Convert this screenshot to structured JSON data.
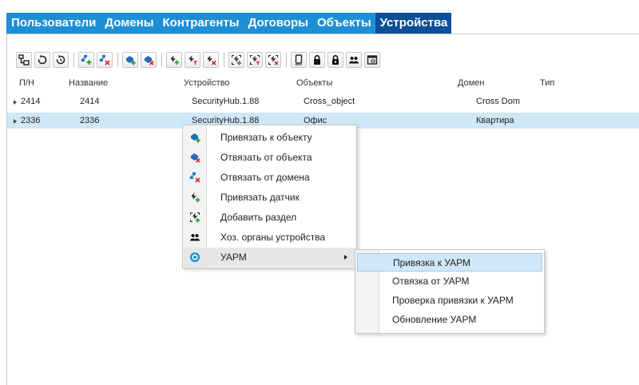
{
  "tabs": [
    {
      "label": "Пользователи",
      "active": false
    },
    {
      "label": "Домены",
      "active": false
    },
    {
      "label": "Контрагенты",
      "active": false
    },
    {
      "label": "Договоры",
      "active": false
    },
    {
      "label": "Объекты",
      "active": false
    },
    {
      "label": "Устройства",
      "active": true
    }
  ],
  "toolbar": {
    "icons": [
      "device-tree-icon",
      "refresh-icon",
      "refresh-timer-icon",
      "domain-bind-icon",
      "domain-unbind-icon",
      "object-bind-icon",
      "object-unbind-icon",
      "sensor-add-icon",
      "sensor-edit-icon",
      "sensor-remove-icon",
      "section-add-icon",
      "section-edit-icon",
      "section-remove-icon",
      "device-phone-icon",
      "lock-icon",
      "lock-arm-icon",
      "users-icon",
      "window-icon"
    ]
  },
  "columns": {
    "pn": "П/Н",
    "name": "Название",
    "device": "Устройство",
    "objects": "Объекты",
    "domain": "Домен",
    "type": "Тип"
  },
  "rows": [
    {
      "pn": "2414",
      "name": "2414",
      "device": "SecurityHub.1.88",
      "objects": "Cross_object",
      "domain": "Cross Dom",
      "type": "",
      "selected": false
    },
    {
      "pn": "2336",
      "name": "2336",
      "device": "SecurityHub.1.88",
      "objects": "Офис",
      "domain": "Квартира",
      "type": "",
      "selected": true
    }
  ],
  "context_menu": {
    "items": [
      {
        "label": "Привязать к объекту",
        "icon": "object-bind-icon"
      },
      {
        "label": "Отвязать от объекта",
        "icon": "object-unbind-icon"
      },
      {
        "label": "Отвязать от домена",
        "icon": "domain-unbind-icon"
      },
      {
        "label": "Привязать датчик",
        "icon": "sensor-add-icon"
      },
      {
        "label": "Добавить раздел",
        "icon": "section-add-icon"
      },
      {
        "label": "Хоз. органы устройства",
        "icon": "users-icon"
      },
      {
        "label": "УАРМ",
        "icon": "uarm-icon",
        "submenu": true,
        "highlighted": true
      }
    ]
  },
  "submenu": {
    "items": [
      {
        "label": "Привязка к УАРМ",
        "highlighted": true
      },
      {
        "label": "Отвязка от УАРМ"
      },
      {
        "label": "Проверка привязки к УАРМ"
      },
      {
        "label": "Обновление УАРМ"
      }
    ]
  },
  "colors": {
    "tab_bar": "#1c8fd6",
    "tab_active": "#0b4f98",
    "selected_row": "#cfe7f7",
    "icon_green": "#2e9e3c",
    "icon_red": "#d62f2f",
    "icon_blue": "#1f6fb8"
  }
}
